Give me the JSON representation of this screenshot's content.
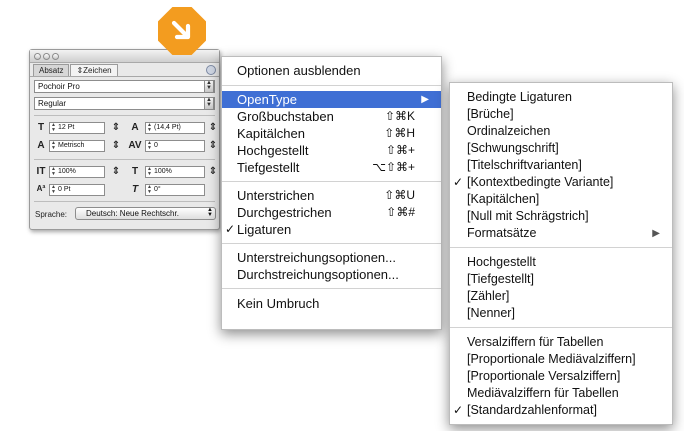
{
  "palette": {
    "tabs": [
      "Absatz",
      "Zeichen"
    ],
    "font_family": "Pochoir Pro",
    "font_style": "Regular",
    "font_size": "12 Pt",
    "leading": "(14,4 Pt)",
    "kerning": "Metrisch",
    "tracking": "0",
    "vertical_scale": "100%",
    "horizontal_scale": "100%",
    "baseline_shift": "0 Pt",
    "skew": "0°",
    "language_label": "Sprache:",
    "language_value": "Deutsch: Neue Rechtschr."
  },
  "badge": {
    "color": "#f39c1f",
    "icon": "arrow-down-right-icon"
  },
  "menu": {
    "items": [
      {
        "label": "Optionen ausblenden",
        "shortcut": ""
      },
      {
        "label": "OpenType",
        "shortcut": "",
        "submenu": true
      },
      {
        "label": "Großbuchstaben",
        "shortcut": "⇧⌘K"
      },
      {
        "label": "Kapitälchen",
        "shortcut": "⇧⌘H"
      },
      {
        "label": "Hochgestellt",
        "shortcut": "⇧⌘+"
      },
      {
        "label": "Tiefgestellt",
        "shortcut": "⌥⇧⌘+"
      },
      {
        "label": "Unterstrichen",
        "shortcut": "⇧⌘U"
      },
      {
        "label": "Durchgestrichen",
        "shortcut": "⇧⌘#"
      },
      {
        "label": "Ligaturen",
        "shortcut": "",
        "checked": true
      },
      {
        "label": "Unterstreichungsoptionen...",
        "shortcut": ""
      },
      {
        "label": "Durchstreichungsoptionen...",
        "shortcut": ""
      },
      {
        "label": "Kein Umbruch",
        "shortcut": ""
      }
    ]
  },
  "submenu": {
    "items": [
      {
        "label": "Bedingte Ligaturen"
      },
      {
        "label": "[Brüche]"
      },
      {
        "label": "Ordinalzeichen"
      },
      {
        "label": "[Schwungschrift]"
      },
      {
        "label": "[Titelschriftvarianten]"
      },
      {
        "label": "[Kontextbedingte Variante]",
        "checked": true
      },
      {
        "label": "[Kapitälchen]"
      },
      {
        "label": "[Null mit Schrägstrich]"
      },
      {
        "label": "Formatsätze",
        "submenu": true
      },
      {
        "label": "Hochgestellt"
      },
      {
        "label": "[Tiefgestellt]"
      },
      {
        "label": "[Zähler]"
      },
      {
        "label": "[Nenner]"
      },
      {
        "label": "Versalziffern für Tabellen"
      },
      {
        "label": "[Proportionale Mediävalziffern]"
      },
      {
        "label": "[Proportionale Versalziffern]"
      },
      {
        "label": "Mediävalziffern für Tabellen"
      },
      {
        "label": "[Standardzahlenformat]",
        "checked": true
      }
    ]
  },
  "colors": {
    "highlight": "#3f6fd4",
    "badge": "#f39c1f"
  }
}
